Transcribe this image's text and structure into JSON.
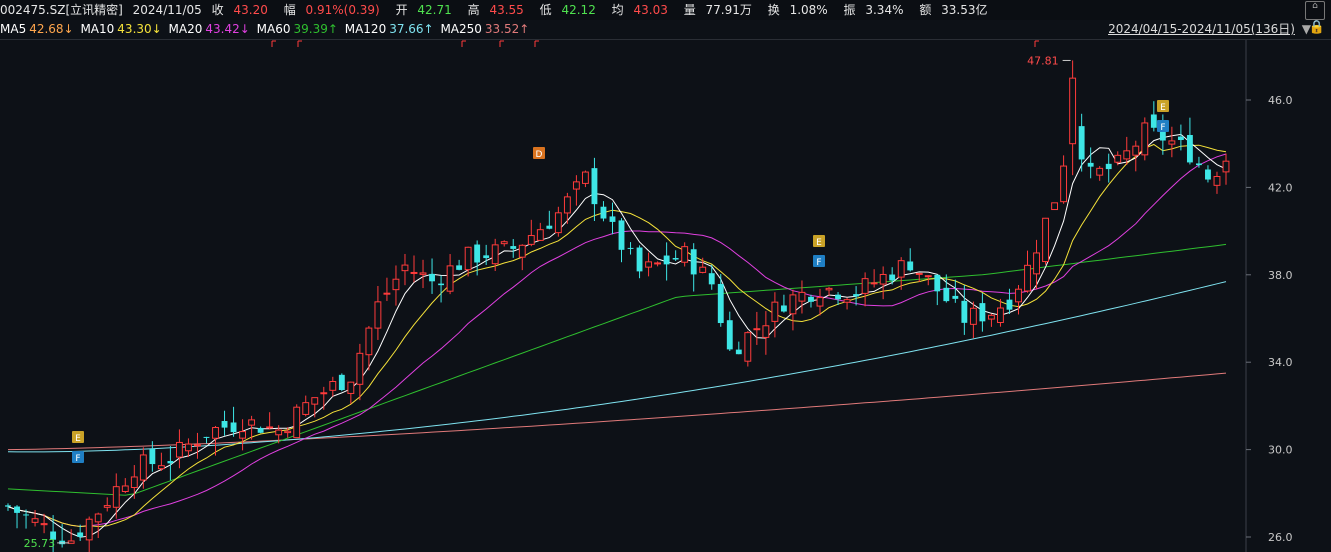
{
  "header": {
    "code": "002475.SZ[立讯精密]",
    "date": "2024/11/05",
    "close_label": "收",
    "close": "43.20",
    "change_label": "幅",
    "change": "0.91%(0.39)",
    "open_label": "开",
    "open": "42.71",
    "high_label": "高",
    "high": "43.55",
    "low_label": "低",
    "low": "42.12",
    "avg_label": "均",
    "avg": "43.03",
    "vol_label": "量",
    "vol": "77.91万",
    "turnover_label": "换",
    "turnover": "1.08%",
    "amp_label": "振",
    "amp": "3.34%",
    "amount_label": "额",
    "amount": "33.53亿"
  },
  "ma_bar": {
    "ma5_label": "MA5",
    "ma5": "42.68↓",
    "ma10_label": "MA10",
    "ma10": "43.30↓",
    "ma20_label": "MA20",
    "ma20": "43.42↓",
    "ma60_label": "MA60",
    "ma60": "39.39↑",
    "ma120_label": "MA120",
    "ma120": "37.66↑",
    "ma250_label": "MA250",
    "ma250": "33.52↑",
    "date_range": "2024/04/15-2024/11/05(136日)"
  },
  "colors": {
    "up": "#ff3b3b",
    "down": "#3ee6e6",
    "ma5": "#ffffff",
    "ma10": "#f5e23a",
    "ma20": "#e040e0",
    "ma60": "#2fbf2f",
    "ma120": "#7fe3f0",
    "ma250": "#e07a7a"
  },
  "chart_data": {
    "type": "candlestick",
    "count": 136,
    "ylim": [
      25.5,
      48.5
    ],
    "yticks": [
      "26.0",
      "30.0",
      "34.0",
      "38.0",
      "42.0",
      "46.0"
    ],
    "annotations": {
      "high": "47.81",
      "low": "25.73"
    },
    "event_markers": [
      {
        "label": "E",
        "index": 11
      },
      {
        "label": "F",
        "index": 11
      },
      {
        "label": "D",
        "index": 83
      },
      {
        "label": "E",
        "index": 126
      },
      {
        "label": "F",
        "index": 126
      },
      {
        "label": "E",
        "index": 178
      },
      {
        "label": "F",
        "index": 178
      }
    ]
  }
}
